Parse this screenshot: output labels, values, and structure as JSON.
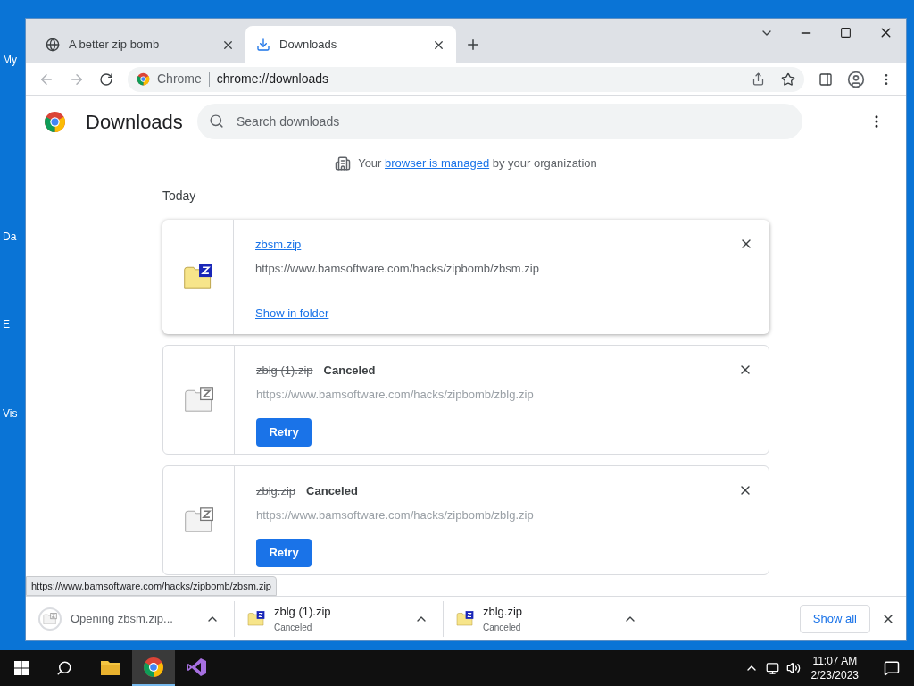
{
  "desktop": {
    "icon_labels": [
      "My",
      "Da",
      "E",
      "Vis"
    ]
  },
  "browser": {
    "tabs": [
      {
        "title": "A better zip bomb",
        "selected": false,
        "kind": "globe"
      },
      {
        "title": "Downloads",
        "selected": true,
        "kind": "download"
      }
    ],
    "omnibox": {
      "site": "Chrome",
      "url": "chrome://downloads"
    }
  },
  "page": {
    "title": "Downloads",
    "search": {
      "placeholder": "Search downloads"
    },
    "managed_notice": {
      "before": "Your",
      "link": "browser is managed",
      "after": "by your organization"
    },
    "section": "Today",
    "items": [
      {
        "name": "zbsm.zip",
        "canceled": false,
        "url": "https://www.bamsoftware.com/hacks/zipbomb/zbsm.zip",
        "action": "Show in folder",
        "kind": "link"
      },
      {
        "name": "zblg (1).zip",
        "status": "Canceled",
        "canceled": true,
        "url": "https://www.bamsoftware.com/hacks/zipbomb/zblg.zip",
        "action": "Retry",
        "kind": "button"
      },
      {
        "name": "zblg.zip",
        "status": "Canceled",
        "canceled": true,
        "url": "https://www.bamsoftware.com/hacks/zipbomb/zblg.zip",
        "action": "Retry",
        "kind": "button"
      }
    ]
  },
  "status_url": "https://www.bamsoftware.com/hacks/zipbomb/zbsm.zip",
  "shelf": {
    "items": [
      {
        "name": "Opening zbsm.zip...",
        "kind": "opening"
      },
      {
        "name": "zblg (1).zip",
        "detail": "Canceled",
        "kind": "done"
      },
      {
        "name": "zblg.zip",
        "detail": "Canceled",
        "kind": "done"
      }
    ],
    "show_all": "Show all"
  },
  "taskbar": {
    "apps": [
      {
        "kind": "folder",
        "selected": false
      },
      {
        "kind": "chrome",
        "selected": true
      },
      {
        "kind": "studio",
        "selected": false
      }
    ],
    "time": "11:07 AM",
    "date": "2/23/2023"
  }
}
